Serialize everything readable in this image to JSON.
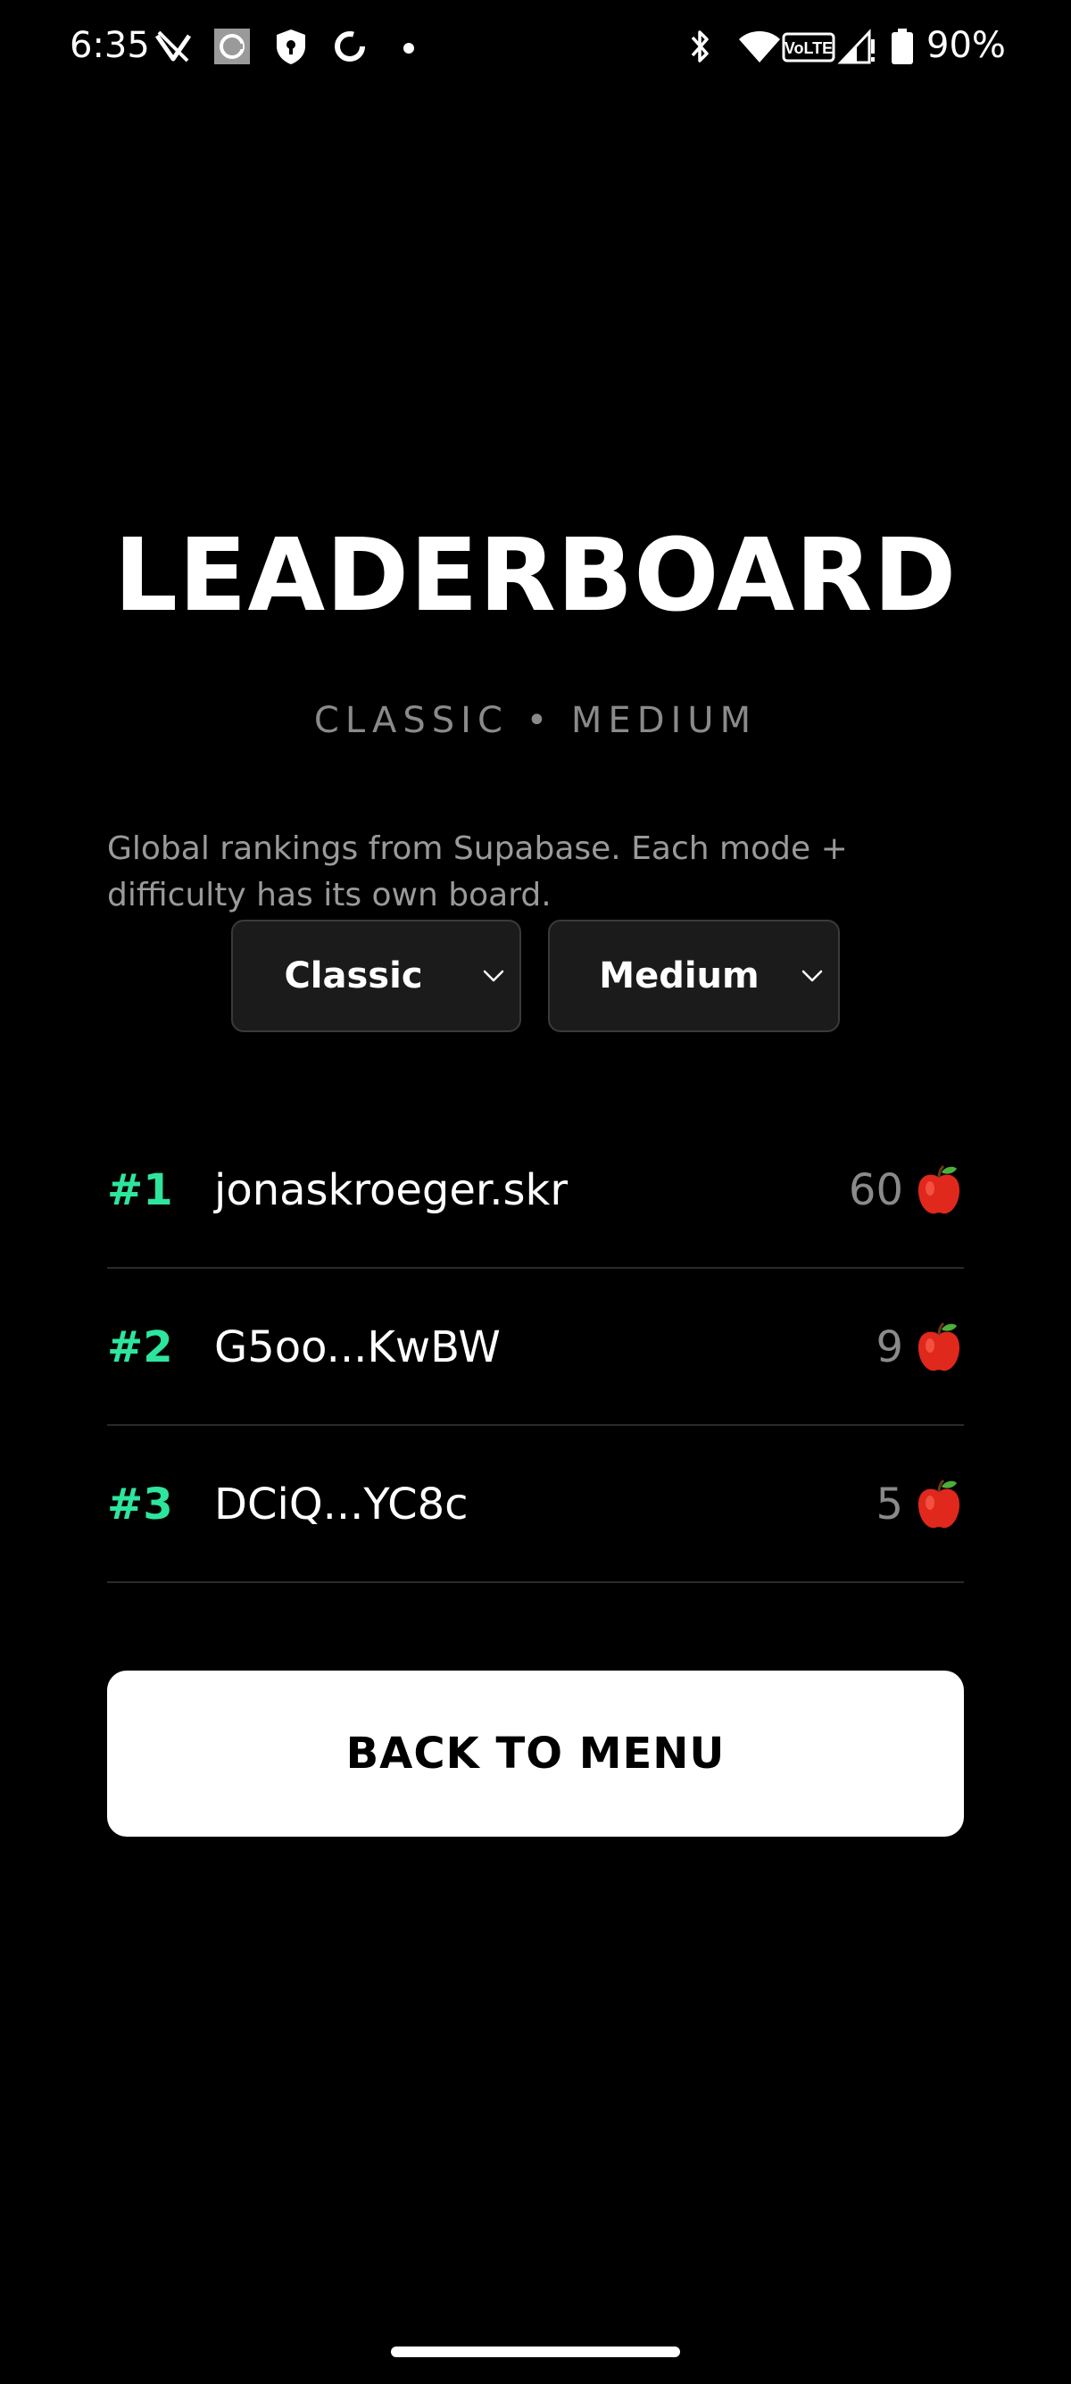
{
  "status_bar": {
    "time": "6:35",
    "battery_percent": "90%",
    "left_icons": [
      "no-signal-app-icon",
      "square-app-icon",
      "shield-icon",
      "sync-icon",
      "dot-icon"
    ],
    "right_icons": [
      "bluetooth-icon",
      "wifi-icon",
      "volte-icon",
      "signal-icon",
      "battery-icon"
    ]
  },
  "header": {
    "title": "LEADERBOARD",
    "subtitle": "CLASSIC • MEDIUM"
  },
  "description": "Global rankings from Supabase. Each mode + difficulty has its own board.",
  "filters": {
    "mode": {
      "selected": "Classic"
    },
    "difficulty": {
      "selected": "Medium"
    }
  },
  "leaderboard": [
    {
      "rank": "#1",
      "name": "jonaskroeger.skr",
      "score": "60",
      "icon": "apple-icon"
    },
    {
      "rank": "#2",
      "name": "G5oo...KwBW",
      "score": "9",
      "icon": "apple-icon"
    },
    {
      "rank": "#3",
      "name": "DCiQ...YC8c",
      "score": "5",
      "icon": "apple-icon"
    }
  ],
  "back_button": {
    "label": "BACK TO MENU"
  },
  "colors": {
    "background": "#000000",
    "accent_rank": "#2ee59d",
    "muted_text": "#8a8a8a",
    "button_bg": "#ffffff",
    "divider": "#2a2a2a"
  }
}
